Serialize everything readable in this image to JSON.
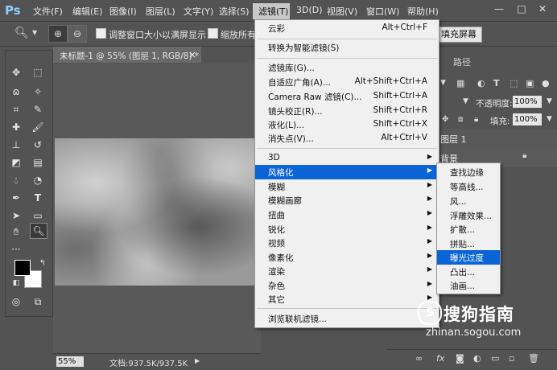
{
  "app": {
    "logo": "Ps"
  },
  "menubar": {
    "items": [
      "文件(F)",
      "编辑(E)",
      "图像(I)",
      "图层(L)",
      "文字(Y)",
      "选择(S)",
      "滤镜(T)",
      "3D(D)",
      "视图(V)",
      "窗口(W)",
      "帮助(H)"
    ],
    "window_controls": {
      "minimize": "—",
      "maximize": "□",
      "close": "✕"
    }
  },
  "options": {
    "zoom_in_icon": "⊕",
    "zoom_out_icon": "⊖",
    "resize_windows_label": "调整窗口大小以满屏显示",
    "zoom_all_label": "缩放所有",
    "fill_screen_label": "填充屏幕"
  },
  "document": {
    "tab_title": "未标题-1 @ 55% (图层 1, RGB/8) *",
    "close": "×",
    "zoom_value": "55%",
    "doc_info": "文档:937.5K/937.5K",
    "status_arrow": "▶"
  },
  "panel": {
    "tabs": [
      "路径"
    ],
    "opacity_label": "不透明度:",
    "opacity_value": "100%",
    "fill_label": "填充:",
    "fill_value": "100%",
    "layers": [
      {
        "name": "图层 1"
      },
      {
        "name": "背景"
      }
    ],
    "bottom_icons": [
      "∞",
      "fx",
      "◙",
      "◐",
      "▭",
      "▫",
      "🗑"
    ]
  },
  "filter_menu": {
    "items": [
      {
        "label": "云彩",
        "shortcut": "Alt+Ctrl+F"
      },
      {
        "label": "转换为智能滤镜(S)",
        "shortcut": ""
      },
      {
        "label": "滤镜库(G)...",
        "shortcut": ""
      },
      {
        "label": "自适应广角(A)...",
        "shortcut": "Alt+Shift+Ctrl+A"
      },
      {
        "label": "Camera Raw 滤镜(C)...",
        "shortcut": "Shift+Ctrl+A"
      },
      {
        "label": "镜头校正(R)...",
        "shortcut": "Shift+Ctrl+R"
      },
      {
        "label": "液化(L)...",
        "shortcut": "Shift+Ctrl+X"
      },
      {
        "label": "消失点(V)...",
        "shortcut": "Alt+Ctrl+V"
      },
      {
        "label": "3D",
        "shortcut": ""
      },
      {
        "label": "风格化",
        "shortcut": ""
      },
      {
        "label": "模糊",
        "shortcut": ""
      },
      {
        "label": "模糊画廊",
        "shortcut": ""
      },
      {
        "label": "扭曲",
        "shortcut": ""
      },
      {
        "label": "锐化",
        "shortcut": ""
      },
      {
        "label": "视频",
        "shortcut": ""
      },
      {
        "label": "像素化",
        "shortcut": ""
      },
      {
        "label": "渲染",
        "shortcut": ""
      },
      {
        "label": "杂色",
        "shortcut": ""
      },
      {
        "label": "其它",
        "shortcut": ""
      },
      {
        "label": "浏览联机滤镜...",
        "shortcut": ""
      }
    ],
    "arrow": "▶"
  },
  "stylize_submenu": {
    "items": [
      "查找边缘",
      "等高线...",
      "风...",
      "浮雕效果...",
      "扩散...",
      "拼贴...",
      "曝光过度",
      "凸出...",
      "油画..."
    ]
  },
  "watermark": {
    "logo": "S",
    "text": "搜狗指南",
    "url": "zhinan.sogou.com"
  },
  "colors": {
    "accent": "#0a64d6",
    "ui_bg": "#535353",
    "menu_bg": "#f0f0f0"
  }
}
